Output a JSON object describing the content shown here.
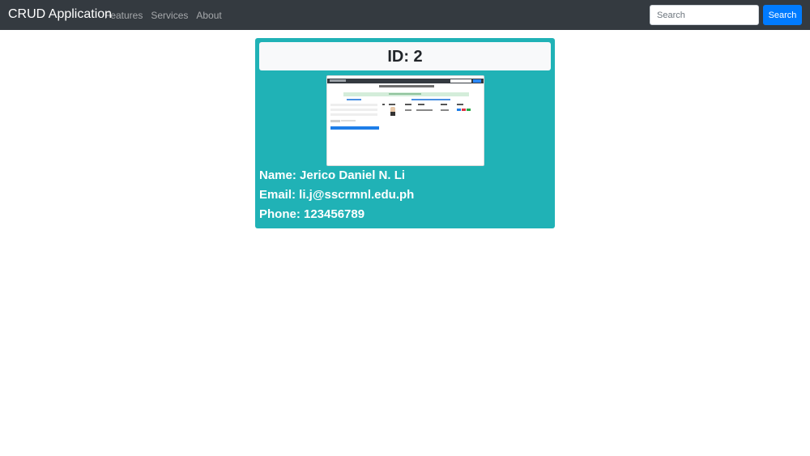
{
  "navbar": {
    "brand": "CRUD Application",
    "links": [
      "Features",
      "Services",
      "About"
    ],
    "search_placeholder": "Search",
    "search_button": "Search"
  },
  "card": {
    "title": "ID: 2",
    "thumbnail_alt": "screenshot-image",
    "name": "Name: Jerico Daniel N. Li",
    "email": "Email: li.j@sscrmnl.edu.ph",
    "phone": "Phone: 123456789"
  },
  "colors": {
    "navbar_bg": "#343a40",
    "card_bg": "#20b2b6",
    "primary": "#007bff"
  }
}
